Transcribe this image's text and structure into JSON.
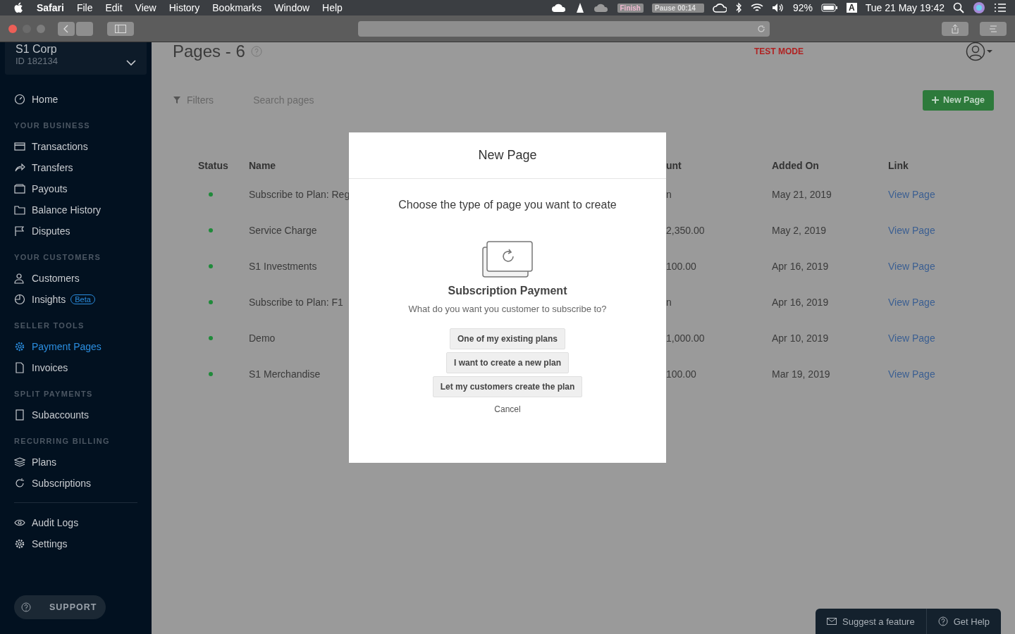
{
  "menubar": {
    "app": "Safari",
    "menus": [
      "File",
      "Edit",
      "View",
      "History",
      "Bookmarks",
      "Window",
      "Help"
    ],
    "finish": "Finish",
    "pause": "Pause 00:14",
    "battery": "92%",
    "input": "A",
    "clock": "Tue 21 May  19:42"
  },
  "account": {
    "name": "S1 Corp",
    "id": "ID 182134"
  },
  "sidebar": {
    "groups": [
      {
        "items": [
          {
            "label": "Home",
            "selected": false
          }
        ]
      },
      {
        "heading": "YOUR BUSINESS",
        "items": [
          {
            "label": "Transactions",
            "selected": false
          },
          {
            "label": "Transfers",
            "selected": false
          },
          {
            "label": "Payouts",
            "selected": false
          },
          {
            "label": "Balance History",
            "selected": false
          },
          {
            "label": "Disputes",
            "selected": false
          }
        ]
      },
      {
        "heading": "YOUR CUSTOMERS",
        "items": [
          {
            "label": "Customers",
            "selected": false
          },
          {
            "label": "Insights",
            "badge": "Beta",
            "selected": false
          }
        ]
      },
      {
        "heading": "SELLER TOOLS",
        "items": [
          {
            "label": "Payment Pages",
            "selected": true
          },
          {
            "label": "Invoices",
            "selected": false
          }
        ]
      },
      {
        "heading": "SPLIT PAYMENTS",
        "items": [
          {
            "label": "Subaccounts",
            "selected": false
          }
        ]
      },
      {
        "heading": "RECURRING BILLING",
        "items": [
          {
            "label": "Plans",
            "selected": false
          },
          {
            "label": "Subscriptions",
            "selected": false
          }
        ]
      },
      {
        "divider_above": true,
        "items": [
          {
            "label": "Audit Logs",
            "selected": false
          },
          {
            "label": "Settings",
            "selected": false
          }
        ]
      }
    ],
    "support": "SUPPORT"
  },
  "page": {
    "title": "Pages - 6",
    "mode": "TEST MODE",
    "filters": "Filters",
    "search_placeholder": "Search pages",
    "new_button": "New Page"
  },
  "table": {
    "columns": [
      "Status",
      "Name",
      "unt",
      "Added On",
      "Link"
    ],
    "rows": [
      {
        "active": true,
        "name": "Subscribe to Plan: Reg",
        "amount": "n",
        "added": "May 21, 2019",
        "link": "View Page"
      },
      {
        "active": true,
        "name": "Service Charge",
        "amount": "2,350.00",
        "added": "May 2, 2019",
        "link": "View Page"
      },
      {
        "active": true,
        "name": "S1 Investments",
        "amount": "100.00",
        "added": "Apr 16, 2019",
        "link": "View Page"
      },
      {
        "active": true,
        "name": "Subscribe to Plan: F1",
        "amount": "n",
        "added": "Apr 16, 2019",
        "link": "View Page"
      },
      {
        "active": true,
        "name": "Demo",
        "amount": "1,000.00",
        "added": "Apr 10, 2019",
        "link": "View Page"
      },
      {
        "active": true,
        "name": "S1 Merchandise",
        "amount": "100.00",
        "added": "Mar 19, 2019",
        "link": "View Page"
      }
    ]
  },
  "modal": {
    "title": "New Page",
    "prompt": "Choose the type of page you want to create",
    "option_title": "Subscription Payment",
    "option_text": "What do you want you customer to subscribe to?",
    "choices": [
      "One of my existing plans",
      "I want to create a new plan",
      "Let my customers create the plan"
    ],
    "cancel": "Cancel"
  },
  "help": {
    "suggest": "Suggest a feature",
    "get_help": "Get Help"
  }
}
